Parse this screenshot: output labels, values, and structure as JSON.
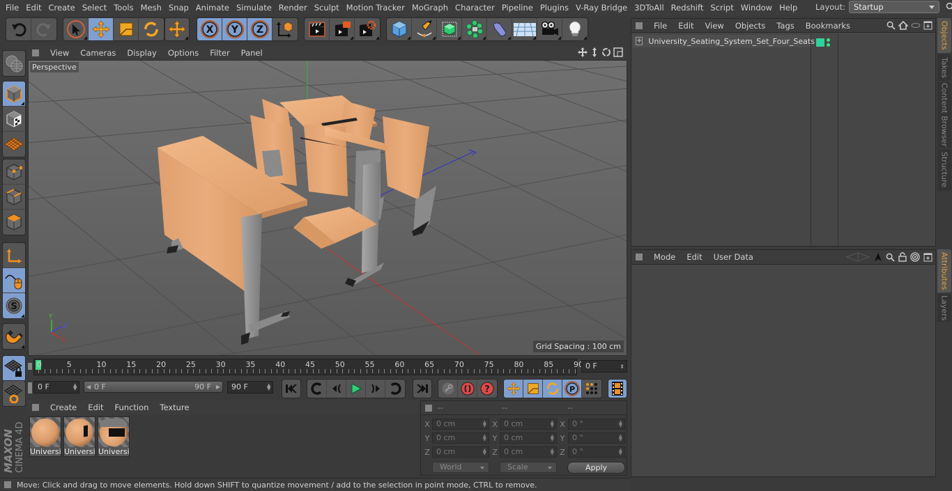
{
  "menubar": {
    "items": [
      "File",
      "Edit",
      "Create",
      "Select",
      "Tools",
      "Mesh",
      "Snap",
      "Animate",
      "Simulate",
      "Render",
      "Sculpt",
      "Motion Tracker",
      "MoGraph",
      "Character",
      "Pipeline",
      "Plugins",
      "V-Ray Bridge",
      "3DToAll",
      "Redshift",
      "Script",
      "Window",
      "Help"
    ],
    "layout_label": "Layout:",
    "layout_value": "Startup"
  },
  "toolbar": {
    "undo": "undo-icon",
    "redo": "redo-icon",
    "tools": [
      "live-selection",
      "move",
      "scale",
      "rotate",
      "last-tool"
    ],
    "axes": [
      "X",
      "Y",
      "Z"
    ],
    "coordinate_system": "world-coordinates",
    "render": [
      "render-view",
      "render-to-picture-viewer",
      "render-settings"
    ],
    "create": [
      "cube",
      "pen-spline",
      "subdivision-surface",
      "cloner",
      "deformer",
      "floor",
      "camera",
      "light"
    ]
  },
  "viewport": {
    "menu": [
      "View",
      "Cameras",
      "Display",
      "Options",
      "Filter",
      "Panel"
    ],
    "camera_label": "Perspective",
    "grid_spacing": "Grid Spacing : 100 cm",
    "axis_labels": {
      "x": "X",
      "y": "Y",
      "z": "Z"
    },
    "colors": {
      "bg": "#5c5c5c",
      "wood": "#e9a877",
      "metal": "#8c8c8c",
      "x_axis": "#c83232",
      "y_axis": "#32b432",
      "z_axis": "#3232c8"
    }
  },
  "timeline": {
    "ticks": [
      0,
      5,
      10,
      15,
      20,
      25,
      30,
      35,
      40,
      45,
      50,
      55,
      60,
      65,
      70,
      75,
      80,
      85,
      90
    ],
    "current_frame": "0 F",
    "start": "0 F",
    "range_start": "0 F",
    "range_end": "90 F",
    "end": "90 F",
    "playhead_color": "#3ddc84"
  },
  "materials": {
    "menu": [
      "Create",
      "Edit",
      "Function",
      "Texture"
    ],
    "items": [
      {
        "label": "Universi"
      },
      {
        "label": "Universi"
      },
      {
        "label": "Universi"
      }
    ]
  },
  "coordinates": {
    "headers": [
      "--",
      "--",
      "--"
    ],
    "rows": [
      {
        "axis": "X",
        "pos": "0 cm",
        "size": "0 cm",
        "rot": "0 °"
      },
      {
        "axis": "Y",
        "pos": "0 cm",
        "size": "0 cm",
        "rot": "0 °"
      },
      {
        "axis": "Z",
        "pos": "0 cm",
        "size": "0 cm",
        "rot": "0 °"
      }
    ],
    "mode": "World",
    "transform": "Scale",
    "apply": "Apply"
  },
  "status": "Move: Click and drag to move elements. Hold down SHIFT to quantize movement / add to the selection in point mode, CTRL to remove.",
  "brand": {
    "line1": "MAXON",
    "line2": "CINEMA 4D"
  },
  "objects": {
    "menu": [
      "File",
      "Edit",
      "View",
      "Objects",
      "Tags",
      "Bookmarks"
    ],
    "items": [
      {
        "name": "University_Seating_System_Set_Four_Seats",
        "layer_color": "#2ed39a"
      }
    ]
  },
  "attributes": {
    "menu": [
      "Mode",
      "Edit",
      "User Data"
    ]
  },
  "side_tabs": {
    "top": [
      {
        "label": "Objects",
        "active": true
      },
      {
        "label": "Takes",
        "active": false
      },
      {
        "label": "Content Browser",
        "active": false
      },
      {
        "label": "Structure",
        "active": false
      }
    ],
    "bottom": [
      {
        "label": "Attributes",
        "active": true
      },
      {
        "label": "Layers",
        "active": false
      }
    ]
  }
}
